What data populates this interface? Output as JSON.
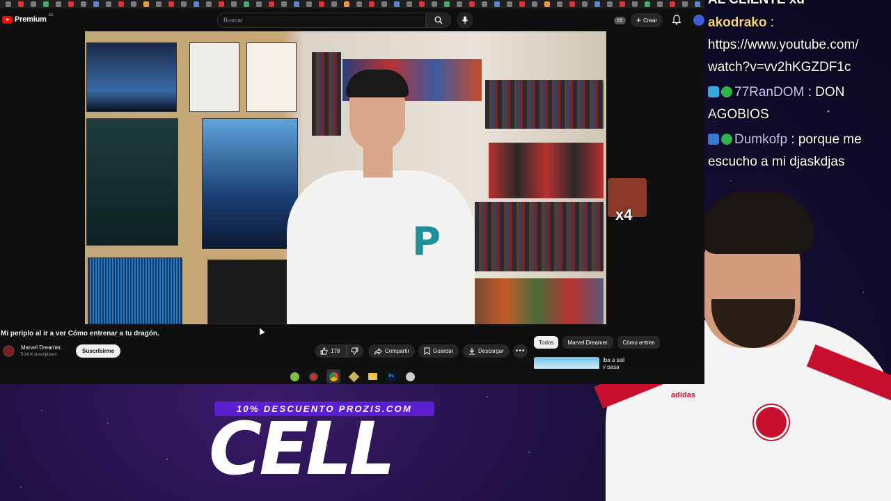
{
  "youtube": {
    "logo_text": "Premium",
    "logo_country": "ES",
    "search_placeholder": "Buscar",
    "ss_badge": "SS",
    "create_label": "Crear",
    "video_title": "Mi periplo al ir a ver Cómo entrenar a tu dragón.",
    "channel_name": "Marvel Dreamer.",
    "channel_subs": "5,34 K suscriptores",
    "subscribe_label": "Suscribirme",
    "like_count": "178",
    "share_label": "Compartir",
    "save_label": "Guardar",
    "download_label": "Descargar",
    "chips": [
      "Todos",
      "Marvel Dreamer.",
      "Cómo entren"
    ],
    "rec_title": "iba a sali\ny pasa"
  },
  "overlay": {
    "emote_count": "x4",
    "promo_bar": "10% DESCUENTO PROZIS.COM",
    "promo_big": "CELL"
  },
  "chat": {
    "line0": "AL CLIENTE xd",
    "user1": "akodrako",
    "msg1a": "https://www.youtube.com/",
    "msg1b": "watch?v=vv2hKGZDF1c",
    "user2": "77RanDOM",
    "msg2a": ": DON",
    "msg2b": "AGOBIOS",
    "user3": "Dumkofp",
    "msg3a": ": porque me",
    "msg3b": "escucho a mi djaskdjas"
  },
  "colors": {
    "yt_red": "#ff0000",
    "promo_purple": "#5b1fd1",
    "chat_user_gold": "#f5d36b",
    "chat_user_lilac": "#c7c7ff"
  }
}
